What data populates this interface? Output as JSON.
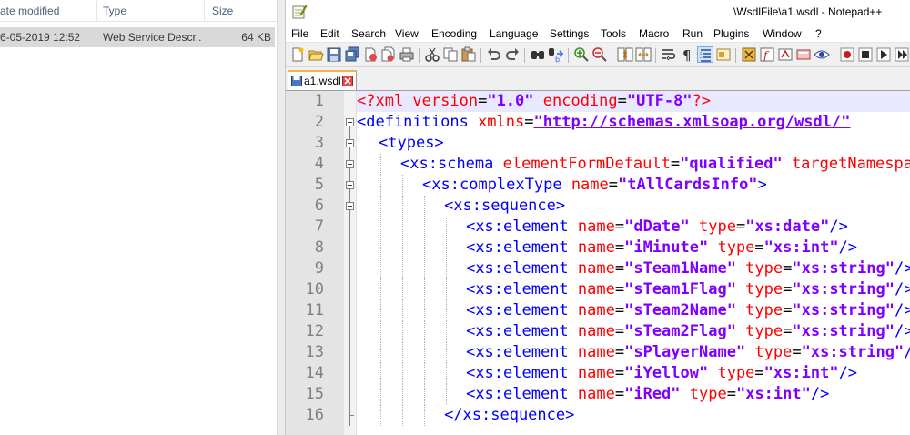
{
  "explorer": {
    "columns": [
      {
        "key": "date",
        "label": "ate modified"
      },
      {
        "key": "type",
        "label": "Type"
      },
      {
        "key": "size",
        "label": "Size"
      }
    ],
    "rows": [
      {
        "date": "6-05-2019 12:52",
        "type": "Web Service Descr...",
        "size": "64 KB"
      }
    ]
  },
  "notepad": {
    "title": "\\WsdlFile\\a1.wsdl - Notepad++",
    "app_icon": "notepad-plus-plus-icon",
    "menu": [
      "File",
      "Edit",
      "Search",
      "View",
      "Encoding",
      "Language",
      "Settings",
      "Tools",
      "Macro",
      "Run",
      "Plugins",
      "Window",
      "?"
    ],
    "toolbar_icons": [
      "new-file-icon",
      "open-file-icon",
      "save-icon",
      "save-all-icon",
      "close-icon",
      "close-all-icon",
      "print-icon",
      "cut-icon",
      "copy-icon",
      "paste-icon",
      "undo-icon",
      "redo-icon",
      "find-icon",
      "replace-icon",
      "zoom-in-icon",
      "zoom-out-icon",
      "sync-vertical-icon",
      "sync-horizontal-icon",
      "word-wrap-icon",
      "show-all-characters-icon",
      "indent-guide-icon",
      "user-defined-language-icon",
      "document-map-icon",
      "function-list-icon",
      "folder-as-workspace-icon",
      "monitoring-icon",
      "record-macro-icon",
      "stop-recording-icon"
    ],
    "tab": {
      "label": "a1.wsdl",
      "icon": "saved-file-icon",
      "close_icon": "tab-close-icon"
    },
    "current_line": 1,
    "lines": [
      {
        "n": "1",
        "indent": 0,
        "fold": "none",
        "tokens": [
          {
            "t": "pi",
            "v": "<?xml "
          },
          {
            "t": "attr",
            "v": "version"
          },
          {
            "t": "eq",
            "v": "="
          },
          {
            "t": "str",
            "v": "\"1.0\""
          },
          {
            "t": "attr",
            "v": " encoding"
          },
          {
            "t": "eq",
            "v": "="
          },
          {
            "t": "str",
            "v": "\"UTF-8\""
          },
          {
            "t": "pi",
            "v": "?>"
          }
        ]
      },
      {
        "n": "2",
        "indent": 0,
        "fold": "open",
        "tokens": [
          {
            "t": "tag",
            "v": "<definitions "
          },
          {
            "t": "attr",
            "v": "xmlns"
          },
          {
            "t": "eq",
            "v": "="
          },
          {
            "t": "url",
            "v": "\"http://schemas.xmlsoap.org/wsdl/\""
          }
        ]
      },
      {
        "n": "3",
        "indent": 1,
        "fold": "open",
        "tokens": [
          {
            "t": "tag",
            "v": "<types>"
          }
        ]
      },
      {
        "n": "4",
        "indent": 2,
        "fold": "open",
        "tokens": [
          {
            "t": "tag",
            "v": "<xs:schema "
          },
          {
            "t": "attr",
            "v": "elementFormDefault"
          },
          {
            "t": "eq",
            "v": "="
          },
          {
            "t": "str",
            "v": "\"qualified\""
          },
          {
            "t": "attr",
            "v": " targetNamespace"
          }
        ]
      },
      {
        "n": "5",
        "indent": 3,
        "fold": "open",
        "tokens": [
          {
            "t": "tag",
            "v": "<xs:complexType "
          },
          {
            "t": "attr",
            "v": "name"
          },
          {
            "t": "eq",
            "v": "="
          },
          {
            "t": "str",
            "v": "\"tAllCardsInfo\""
          },
          {
            "t": "tag",
            "v": ">"
          }
        ]
      },
      {
        "n": "6",
        "indent": 4,
        "fold": "open",
        "tokens": [
          {
            "t": "tag",
            "v": "<xs:sequence>"
          }
        ]
      },
      {
        "n": "7",
        "indent": 5,
        "fold": "line",
        "tokens": [
          {
            "t": "tag",
            "v": "<xs:element "
          },
          {
            "t": "attr",
            "v": "name"
          },
          {
            "t": "eq",
            "v": "="
          },
          {
            "t": "str",
            "v": "\"dDate\""
          },
          {
            "t": "attr",
            "v": " type"
          },
          {
            "t": "eq",
            "v": "="
          },
          {
            "t": "str",
            "v": "\"xs:date\""
          },
          {
            "t": "tag",
            "v": "/>"
          }
        ]
      },
      {
        "n": "8",
        "indent": 5,
        "fold": "line",
        "tokens": [
          {
            "t": "tag",
            "v": "<xs:element "
          },
          {
            "t": "attr",
            "v": "name"
          },
          {
            "t": "eq",
            "v": "="
          },
          {
            "t": "str",
            "v": "\"iMinute\""
          },
          {
            "t": "attr",
            "v": " type"
          },
          {
            "t": "eq",
            "v": "="
          },
          {
            "t": "str",
            "v": "\"xs:int\""
          },
          {
            "t": "tag",
            "v": "/>"
          }
        ]
      },
      {
        "n": "9",
        "indent": 5,
        "fold": "line",
        "tokens": [
          {
            "t": "tag",
            "v": "<xs:element "
          },
          {
            "t": "attr",
            "v": "name"
          },
          {
            "t": "eq",
            "v": "="
          },
          {
            "t": "str",
            "v": "\"sTeam1Name\""
          },
          {
            "t": "attr",
            "v": " type"
          },
          {
            "t": "eq",
            "v": "="
          },
          {
            "t": "str",
            "v": "\"xs:string\""
          },
          {
            "t": "tag",
            "v": "/>"
          }
        ]
      },
      {
        "n": "10",
        "indent": 5,
        "fold": "line",
        "tokens": [
          {
            "t": "tag",
            "v": "<xs:element "
          },
          {
            "t": "attr",
            "v": "name"
          },
          {
            "t": "eq",
            "v": "="
          },
          {
            "t": "str",
            "v": "\"sTeam1Flag\""
          },
          {
            "t": "attr",
            "v": " type"
          },
          {
            "t": "eq",
            "v": "="
          },
          {
            "t": "str",
            "v": "\"xs:string\""
          },
          {
            "t": "tag",
            "v": "/>"
          }
        ]
      },
      {
        "n": "11",
        "indent": 5,
        "fold": "line",
        "tokens": [
          {
            "t": "tag",
            "v": "<xs:element "
          },
          {
            "t": "attr",
            "v": "name"
          },
          {
            "t": "eq",
            "v": "="
          },
          {
            "t": "str",
            "v": "\"sTeam2Name\""
          },
          {
            "t": "attr",
            "v": " type"
          },
          {
            "t": "eq",
            "v": "="
          },
          {
            "t": "str",
            "v": "\"xs:string\""
          },
          {
            "t": "tag",
            "v": "/>"
          }
        ]
      },
      {
        "n": "12",
        "indent": 5,
        "fold": "line",
        "tokens": [
          {
            "t": "tag",
            "v": "<xs:element "
          },
          {
            "t": "attr",
            "v": "name"
          },
          {
            "t": "eq",
            "v": "="
          },
          {
            "t": "str",
            "v": "\"sTeam2Flag\""
          },
          {
            "t": "attr",
            "v": " type"
          },
          {
            "t": "eq",
            "v": "="
          },
          {
            "t": "str",
            "v": "\"xs:string\""
          },
          {
            "t": "tag",
            "v": "/>"
          }
        ]
      },
      {
        "n": "13",
        "indent": 5,
        "fold": "line",
        "tokens": [
          {
            "t": "tag",
            "v": "<xs:element "
          },
          {
            "t": "attr",
            "v": "name"
          },
          {
            "t": "eq",
            "v": "="
          },
          {
            "t": "str",
            "v": "\"sPlayerName\""
          },
          {
            "t": "attr",
            "v": " type"
          },
          {
            "t": "eq",
            "v": "="
          },
          {
            "t": "str",
            "v": "\"xs:string\""
          },
          {
            "t": "tag",
            "v": "/>"
          }
        ]
      },
      {
        "n": "14",
        "indent": 5,
        "fold": "line",
        "tokens": [
          {
            "t": "tag",
            "v": "<xs:element "
          },
          {
            "t": "attr",
            "v": "name"
          },
          {
            "t": "eq",
            "v": "="
          },
          {
            "t": "str",
            "v": "\"iYellow\""
          },
          {
            "t": "attr",
            "v": " type"
          },
          {
            "t": "eq",
            "v": "="
          },
          {
            "t": "str",
            "v": "\"xs:int\""
          },
          {
            "t": "tag",
            "v": "/>"
          }
        ]
      },
      {
        "n": "15",
        "indent": 5,
        "fold": "line",
        "tokens": [
          {
            "t": "tag",
            "v": "<xs:element "
          },
          {
            "t": "attr",
            "v": "name"
          },
          {
            "t": "eq",
            "v": "="
          },
          {
            "t": "str",
            "v": "\"iRed\""
          },
          {
            "t": "attr",
            "v": " type"
          },
          {
            "t": "eq",
            "v": "="
          },
          {
            "t": "str",
            "v": "\"xs:int\""
          },
          {
            "t": "tag",
            "v": "/>"
          }
        ]
      },
      {
        "n": "16",
        "indent": 4,
        "fold": "end",
        "tokens": [
          {
            "t": "tag",
            "v": "</xs:sequence>"
          }
        ]
      }
    ]
  },
  "colors": {
    "tag": "#0000ff",
    "attr": "#ff0000",
    "string": "#8000ff",
    "current_line": "#e8e8ff",
    "gutter": "#e4e4e4",
    "explorer_selection": "#d9d9d9"
  }
}
